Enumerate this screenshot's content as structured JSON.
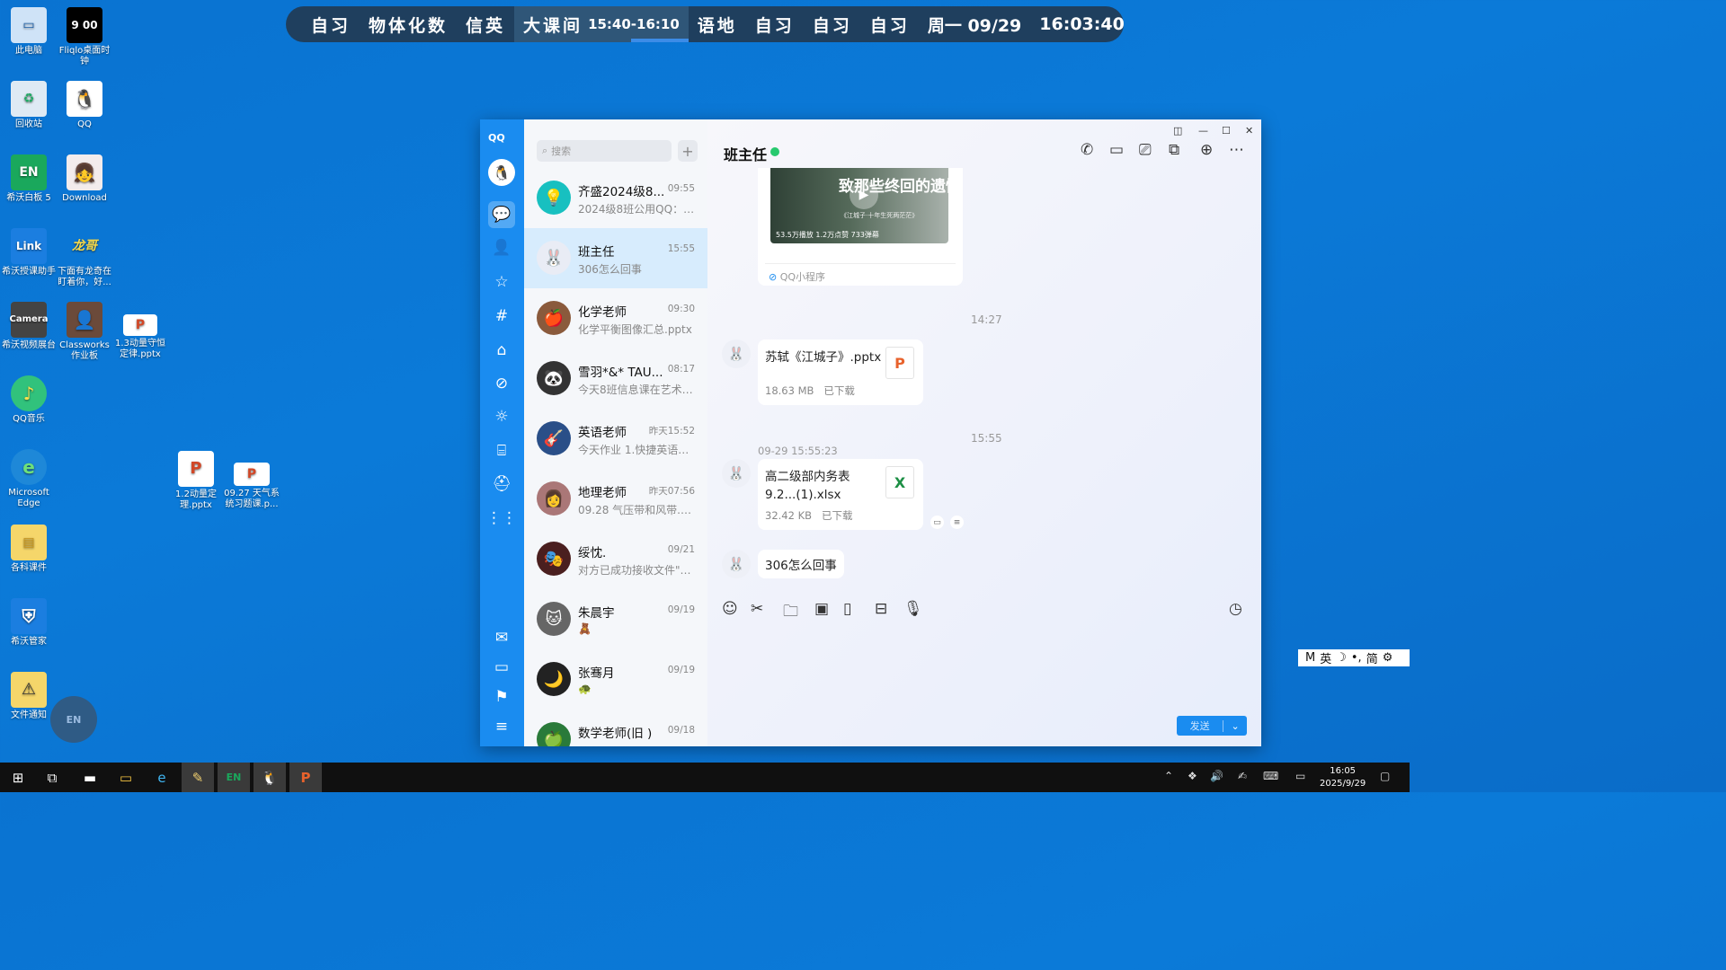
{
  "schedule": {
    "s1": "自习",
    "s2": "物体化数",
    "s3": "信英",
    "s4": "大课间",
    "s4_time": "15:40-16:10",
    "s5": "语地",
    "s6a": "自习",
    "s6b": "自习",
    "s6c": "自习",
    "date": "周一 09/29",
    "clock": "16:03:40"
  },
  "desktop": {
    "icons": [
      {
        "label": "此电脑",
        "icon": "computer-icon"
      },
      {
        "label": "Fliqlo桌面时钟",
        "icon": "clock-icon",
        "glyph": "9 00"
      },
      {
        "label": "回收站",
        "icon": "recycle-bin-icon"
      },
      {
        "label": "QQ",
        "icon": "qq-penguin-icon"
      },
      {
        "label": "希沃白板 5",
        "icon": "seewo-board-icon",
        "glyph": "EN"
      },
      {
        "label": "Download",
        "icon": "anime-icon"
      },
      {
        "label": "希沃授课助手",
        "icon": "link-icon",
        "glyph": "Link"
      },
      {
        "label": "下面有龙奇在盯着你，好...",
        "icon": "dragon-peek-icon",
        "glyph": "龙哥"
      },
      {
        "label": "希沃视频展台",
        "icon": "camera-icon",
        "glyph": "Camera"
      },
      {
        "label": "Classworks作业板",
        "icon": "portrait-icon"
      },
      {
        "label": "1.3动量守恒定律.pptx",
        "icon": "pptx-file-icon"
      },
      {
        "label": "QQ音乐",
        "icon": "qq-music-icon"
      },
      {
        "label": "Microsoft Edge",
        "icon": "edge-icon"
      },
      {
        "label": "1.2动量定理.pptx",
        "icon": "pptx-file-icon"
      },
      {
        "label": "09.27 天气系统习题课.p...",
        "icon": "pptx-file-icon"
      },
      {
        "label": "各科课件",
        "icon": "folder-icon"
      },
      {
        "label": "希沃管家",
        "icon": "shield-icon"
      },
      {
        "label": "文件通知",
        "icon": "warning-folder-icon"
      }
    ],
    "en_button": "EN"
  },
  "qq": {
    "rail_logo": "QQ",
    "search_placeholder": "搜索",
    "conversations": [
      {
        "name": "齐盛2024级8...",
        "time": "09:55",
        "preview": "2024级8班公用QQ：化...",
        "color": "#18c0c0",
        "glyph": "💡"
      },
      {
        "name": "班主任",
        "time": "15:55",
        "preview": "306怎么回事",
        "color": "#e9ecf5",
        "glyph": "🐰"
      },
      {
        "name": "化学老师",
        "time": "09:30",
        "preview": "化学平衡图像汇总.pptx",
        "color": "#8a5a3c",
        "glyph": "🍎"
      },
      {
        "name": "雪羽*&* TAU...",
        "time": "08:17",
        "preview": "今天8班信息课在艺术楼...",
        "color": "#333",
        "glyph": "🐼"
      },
      {
        "name": "英语老师",
        "time": "昨天15:52",
        "preview": "今天作业 1.快捷英语W...",
        "color": "#2a4f88",
        "glyph": "🎸"
      },
      {
        "name": "地理老师",
        "time": "昨天07:56",
        "preview": "09.28 气压带和风带.pptx",
        "color": "#a77",
        "glyph": "👩"
      },
      {
        "name": "绥忱.",
        "time": "09/21",
        "preview": "对方已成功接收文件\"09...",
        "color": "#4a1f1f",
        "glyph": "🎭"
      },
      {
        "name": "朱晨宇",
        "time": "09/19",
        "preview": "🧸",
        "color": "#666",
        "glyph": "🐱"
      },
      {
        "name": "张骞月",
        "time": "09/19",
        "preview": "🐢",
        "color": "#222",
        "glyph": "🌙"
      },
      {
        "name": "数学老师(旧 )",
        "time": "09/18",
        "preview": "",
        "color": "#2a7a3a",
        "glyph": "🍏"
      }
    ],
    "chat": {
      "title": "班主任",
      "video_title": "致那些终回的遗憾",
      "video_sub": "《江城子·十年生死两茫茫》",
      "video_stats": "53.5万播放  1.2万点赞  733弹幕",
      "mini_program": "QQ小程序",
      "time1": "14:27",
      "file1_name": "苏轼《江城子》.pptx",
      "file1_size": "18.63 MB",
      "file1_status": "已下载",
      "time2": "15:55",
      "time3": "09-29 15:55:23",
      "file2_name": "高二级部内务表 9.2...(1).xlsx",
      "file2_size": "32.42 KB",
      "file2_status": "已下载",
      "last_msg": "306怎么回事",
      "send": "发送"
    }
  },
  "ime": {
    "mode": "M",
    "lang": "英",
    "script": "简"
  },
  "taskbar": {
    "time": "16:05",
    "date": "2025/9/29"
  }
}
